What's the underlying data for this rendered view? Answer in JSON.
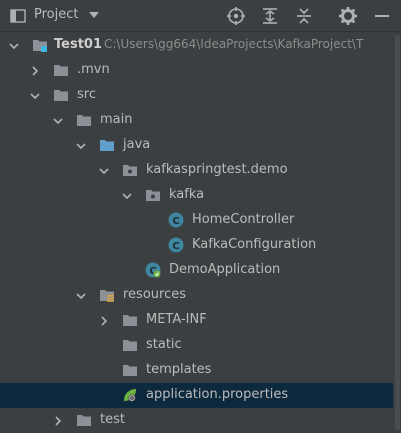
{
  "panel": {
    "title": "Project",
    "icons": [
      "project-view-icon",
      "chevron-down-icon",
      "locate-icon",
      "expand-all-icon",
      "collapse-all-icon",
      "gear-icon",
      "minimize-icon"
    ]
  },
  "tree": {
    "root": {
      "label": "Test01",
      "path": "C:\\Users\\gg664\\IdeaProjects\\KafkaProject\\T"
    },
    "items": [
      {
        "label": ".mvn"
      },
      {
        "label": "src"
      },
      {
        "label": "main"
      },
      {
        "label": "java"
      },
      {
        "label": "kafkaspringtest.demo"
      },
      {
        "label": "kafka"
      },
      {
        "label": "HomeController"
      },
      {
        "label": "KafkaConfiguration"
      },
      {
        "label": "DemoApplication"
      },
      {
        "label": "resources"
      },
      {
        "label": "META-INF"
      },
      {
        "label": "static"
      },
      {
        "label": "templates"
      },
      {
        "label": "application.properties"
      },
      {
        "label": "test"
      }
    ],
    "selected": "application.properties"
  },
  "colors": {
    "background": "#3c3f41",
    "selection": "#0d293e",
    "text": "#bbbbbb",
    "folder": "#8b9196",
    "source_folder": "#5f9fc9",
    "class_icon": "#3e86a0"
  }
}
